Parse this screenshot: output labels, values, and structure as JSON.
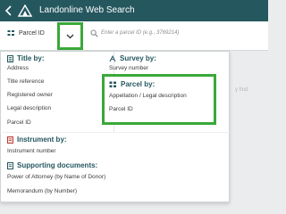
{
  "app": {
    "title": "Landonline Web Search"
  },
  "search": {
    "type_label": "Parcel ID",
    "placeholder": "Enter a parcel ID (e.g., 3769214)",
    "behind_text": "y find"
  },
  "dropdown": {
    "title_by": {
      "heading": "Title by:",
      "items": [
        "Address",
        "Title reference",
        "Registered owner",
        "Legal description",
        "Parcel ID"
      ]
    },
    "survey_by": {
      "heading": "Survey by:",
      "items": [
        "Survey number"
      ]
    },
    "parcel_by": {
      "heading": "Parcel by:",
      "items": [
        "Appellation / Legal description",
        "Parcel ID"
      ]
    },
    "instrument_by": {
      "heading": "Instrument by:",
      "items": [
        "Instrument number"
      ]
    },
    "supporting_docs": {
      "heading": "Supporting documents:",
      "items": [
        "Power of Attorney (by Name of Donor)",
        "Memorandum (by Number)"
      ]
    }
  },
  "colors": {
    "header_bg": "#25575f",
    "accent": "#25575f",
    "highlight_border": "#3aa839",
    "instrument_icon": "#c0392b"
  }
}
